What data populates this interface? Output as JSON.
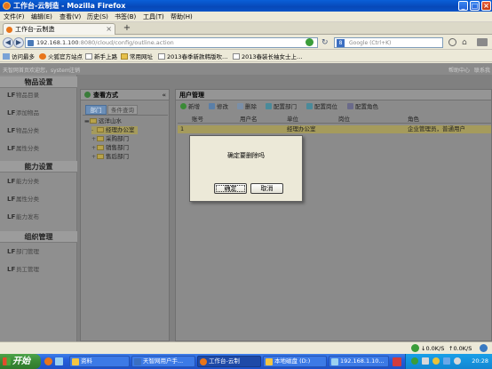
{
  "window": {
    "title": "工作台-云制造 - Mozilla Firefox",
    "min": "_",
    "max": "□",
    "close": "×"
  },
  "menubar": {
    "items": [
      "文件(F)",
      "编辑(E)",
      "查看(V)",
      "历史(S)",
      "书签(B)",
      "工具(T)",
      "帮助(H)"
    ]
  },
  "tabs": {
    "active_label": "工作台-云制造",
    "new_tab": "+",
    "close": "×"
  },
  "nav": {
    "back": "◀",
    "forward": "▶",
    "url_host": "192.168.1.100",
    "url_path": ":8080/cloud/config/outline.action",
    "search_engine": "8",
    "search_placeholder": "Google (Ctrl+K)"
  },
  "bookmarks": [
    "访问最多",
    "火狐官方站点",
    "新手上路",
    "常用网址",
    "2013春季新款韩版吹…",
    "2013春装长袖女士上…"
  ],
  "page": {
    "header_left": [
      "天智网首页",
      "欢迎您，system",
      "注销"
    ],
    "header_right": [
      "帮助中心",
      "联系我"
    ]
  },
  "left_menu": {
    "sections": [
      {
        "title": "物品设置",
        "items": [
          "物品目录",
          "添加物品",
          "物品分类",
          "属性分类"
        ]
      },
      {
        "title": "能力设置",
        "items": [
          "能力分类",
          "属性分类",
          "能力发布"
        ]
      },
      {
        "title": "组织管理",
        "items": [
          "部门管理",
          "员工管理"
        ]
      }
    ]
  },
  "mid_panel": {
    "title": "查看方式",
    "collapse": "«",
    "tabs": [
      "部门",
      "条件查询"
    ],
    "tree": [
      {
        "level": 0,
        "toggle": "▬",
        "label": "远洋山水"
      },
      {
        "level": 1,
        "toggle": "-",
        "label": "经理办公室",
        "selected": true
      },
      {
        "level": 1,
        "toggle": "+",
        "label": "采购部门"
      },
      {
        "level": 1,
        "toggle": "+",
        "label": "销售部门"
      },
      {
        "level": 1,
        "toggle": "+",
        "label": "售后部门"
      }
    ]
  },
  "right_panel": {
    "title": "用户管理",
    "toolbar": [
      "新增",
      "修改",
      "删除",
      "配置部门",
      "配置岗位",
      "配置角色"
    ],
    "columns": [
      "账号",
      "用户名",
      "单位",
      "岗位",
      "角色"
    ],
    "rows": [
      {
        "num": "1",
        "cells": [
          "",
          "",
          "经理办公室",
          "",
          "企业管理员，普通用户"
        ]
      }
    ]
  },
  "dialog": {
    "message": "确定要删除吗",
    "ok": "确定",
    "cancel": "取消"
  },
  "statusbar": {
    "down": "0.0K/S",
    "up": "0.0K/S"
  },
  "taskbar": {
    "start": "开始",
    "tasks": [
      "资料",
      "天智网用户手...",
      "工作台-云制",
      "本地磁盘 (D:)",
      "192.168.1.10..."
    ],
    "clock": "20:28"
  },
  "colors": {
    "titlebar": "#0a54c8",
    "taskbar": "#245edb",
    "start": "#3a8a36",
    "selected_row": "#a59b5c",
    "overlay_bg": "#808080"
  }
}
